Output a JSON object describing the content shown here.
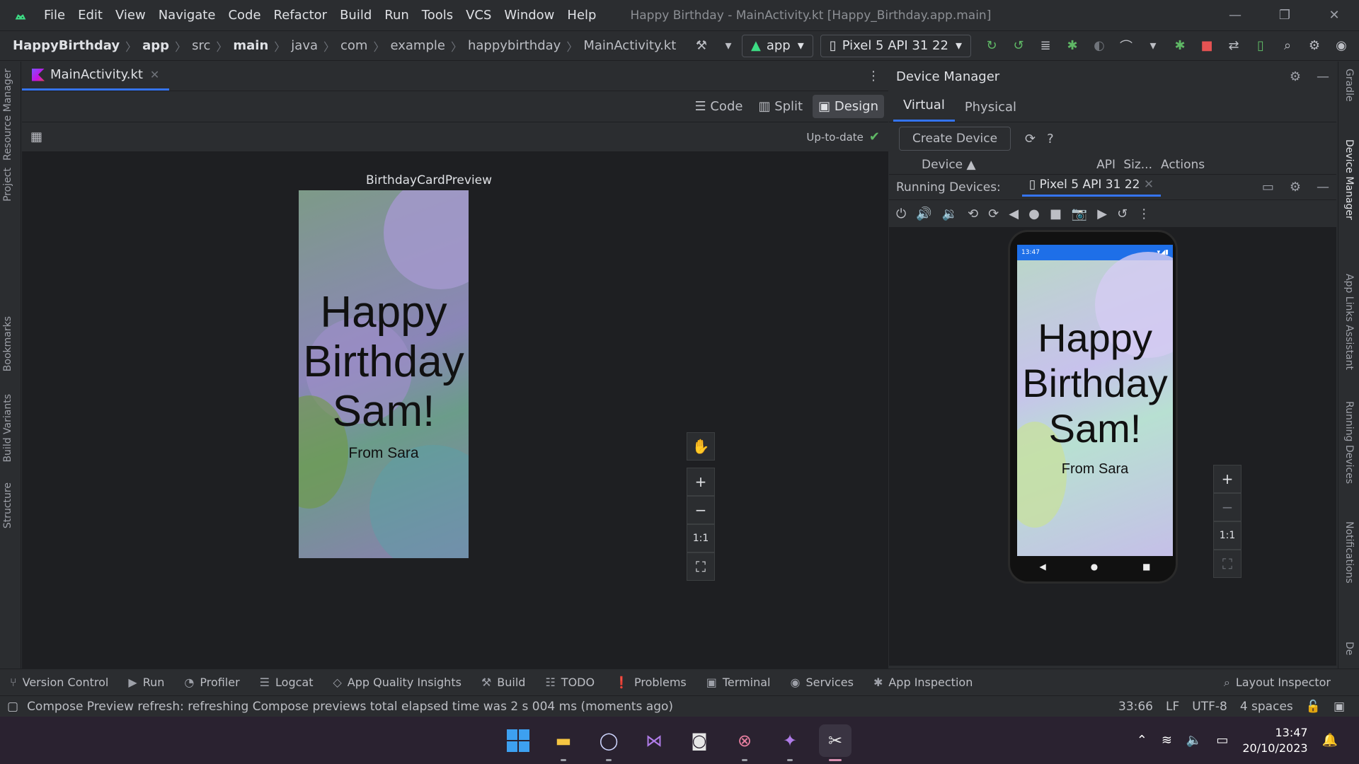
{
  "titlebar": {
    "menu": [
      "File",
      "Edit",
      "View",
      "Navigate",
      "Code",
      "Refactor",
      "Build",
      "Run",
      "Tools",
      "VCS",
      "Window",
      "Help"
    ],
    "window_title": "Happy Birthday - MainActivity.kt [Happy_Birthday.app.main]"
  },
  "navbar": {
    "breadcrumbs": [
      "HappyBirthday",
      "app",
      "src",
      "main",
      "java",
      "com",
      "example",
      "happybirthday",
      "MainActivity.kt"
    ],
    "run_config": "app",
    "device": "Pixel 5 API 31 22"
  },
  "left_tools": [
    "Resource Manager",
    "Project",
    "Bookmarks",
    "Build Variants",
    "Structure"
  ],
  "right_tools": [
    "Gradle",
    "Device Manager",
    "App Links Assistant",
    "Running Devices",
    "Notifications",
    "De"
  ],
  "editor": {
    "tab_label": "MainActivity.kt",
    "modes": [
      "Code",
      "Split",
      "Design"
    ],
    "active_mode": "Design",
    "preview_status": "Up-to-date",
    "preview_name": "BirthdayCardPreview"
  },
  "card": {
    "greeting": [
      "Happy",
      "Birthday",
      "Sam!"
    ],
    "from": "From Sara"
  },
  "zoom": {
    "one_to_one": "1:1"
  },
  "device_manager": {
    "title": "Device Manager",
    "tabs": [
      "Virtual",
      "Physical"
    ],
    "active_tab": "Virtual",
    "create_button": "Create Device",
    "columns": [
      "Device",
      "API",
      "Siz...",
      "Actions"
    ],
    "running_label": "Running Devices:",
    "running_device": "Pixel 5 API 31 22",
    "phone_status_time": "13:47"
  },
  "bottom_tools": [
    "Version Control",
    "Run",
    "Profiler",
    "Logcat",
    "App Quality Insights",
    "Build",
    "TODO",
    "Problems",
    "Terminal",
    "Services",
    "App Inspection",
    "Layout Inspector"
  ],
  "status": {
    "message": "Compose Preview refresh: refreshing Compose previews total elapsed time was 2 s 004 ms (moments ago)",
    "position": "33:66",
    "line_sep": "LF",
    "encoding": "UTF-8",
    "indent": "4 spaces"
  },
  "taskbar": {
    "time": "13:47",
    "date": "20/10/2023"
  },
  "colors": {
    "accent": "#3574f0",
    "ok": "#5fb865",
    "stop": "#e55353"
  }
}
